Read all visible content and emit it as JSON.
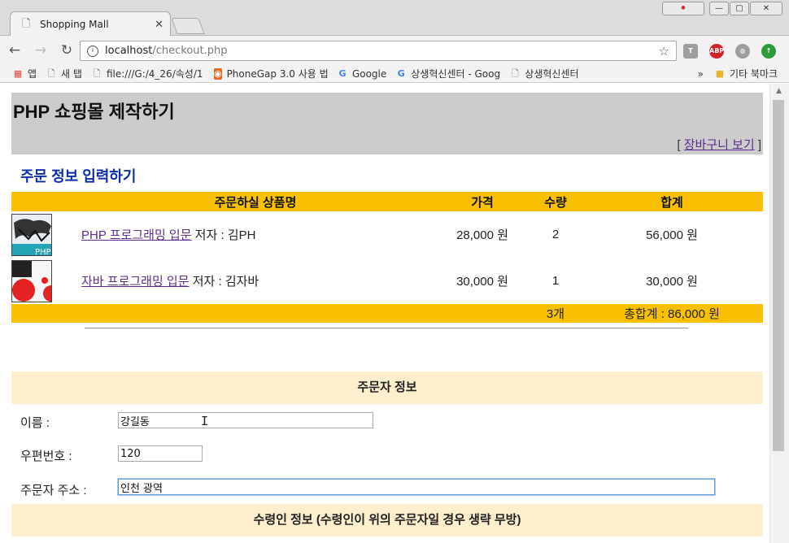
{
  "browser": {
    "tab_title": "Shopping Mall",
    "tab_close": "✕",
    "url_host": "localhost",
    "url_path": "/checkout.php",
    "window_controls": [
      "⚫",
      "—",
      "▢",
      "✕"
    ],
    "extensions": [
      {
        "name": "T",
        "color": "#9e9e9e"
      },
      {
        "name": "ABP",
        "color": "#d0202a"
      },
      {
        "name": "◍",
        "color": "#9e9e9e"
      },
      {
        "name": "↑",
        "color": "#2e9a3a"
      }
    ]
  },
  "bookmarks": {
    "items": [
      "앱",
      "새 탭",
      "file:///G:/4_26/속성/1",
      "PhoneGap 3.0 사용 법",
      "Google",
      "상생혁신센터 - Goog",
      "상생혁신센터"
    ],
    "overflow": "»",
    "other": "기타 북마크"
  },
  "page": {
    "title": "PHP 쇼핑몰 제작하기",
    "cart_link_open": "[ ",
    "cart_link": "장바구니 보기",
    "cart_link_close": " ]",
    "section_title": "주문 정보 입력하기"
  },
  "cart": {
    "headers": [
      "주문하실 상품명",
      "가격",
      "수량",
      "합계"
    ],
    "rows": [
      {
        "name": "PHP 프로그래밍 입문",
        "author": " 저자 : 김PH",
        "price": "28,000 원",
        "qty": "2",
        "subtotal": "56,000 원"
      },
      {
        "name": "자바 프로그래밍 입문",
        "author": " 저자 : 김자바",
        "price": "30,000 원",
        "qty": "1",
        "subtotal": "30,000 원"
      }
    ],
    "total_qty": "3개",
    "total": "총합계 : 86,000 원"
  },
  "orderer": {
    "title": "주문자 정보",
    "name_label": "이름 :",
    "name_value": "강길동",
    "zip_label": "우편번호 :",
    "zip_value": "120",
    "address_label": "주문자 주소 :",
    "address_value": "인천 광역"
  },
  "receiver": {
    "title": "수령인 정보 (수령인이 위의 주문자일 경우 생략 무방)"
  }
}
